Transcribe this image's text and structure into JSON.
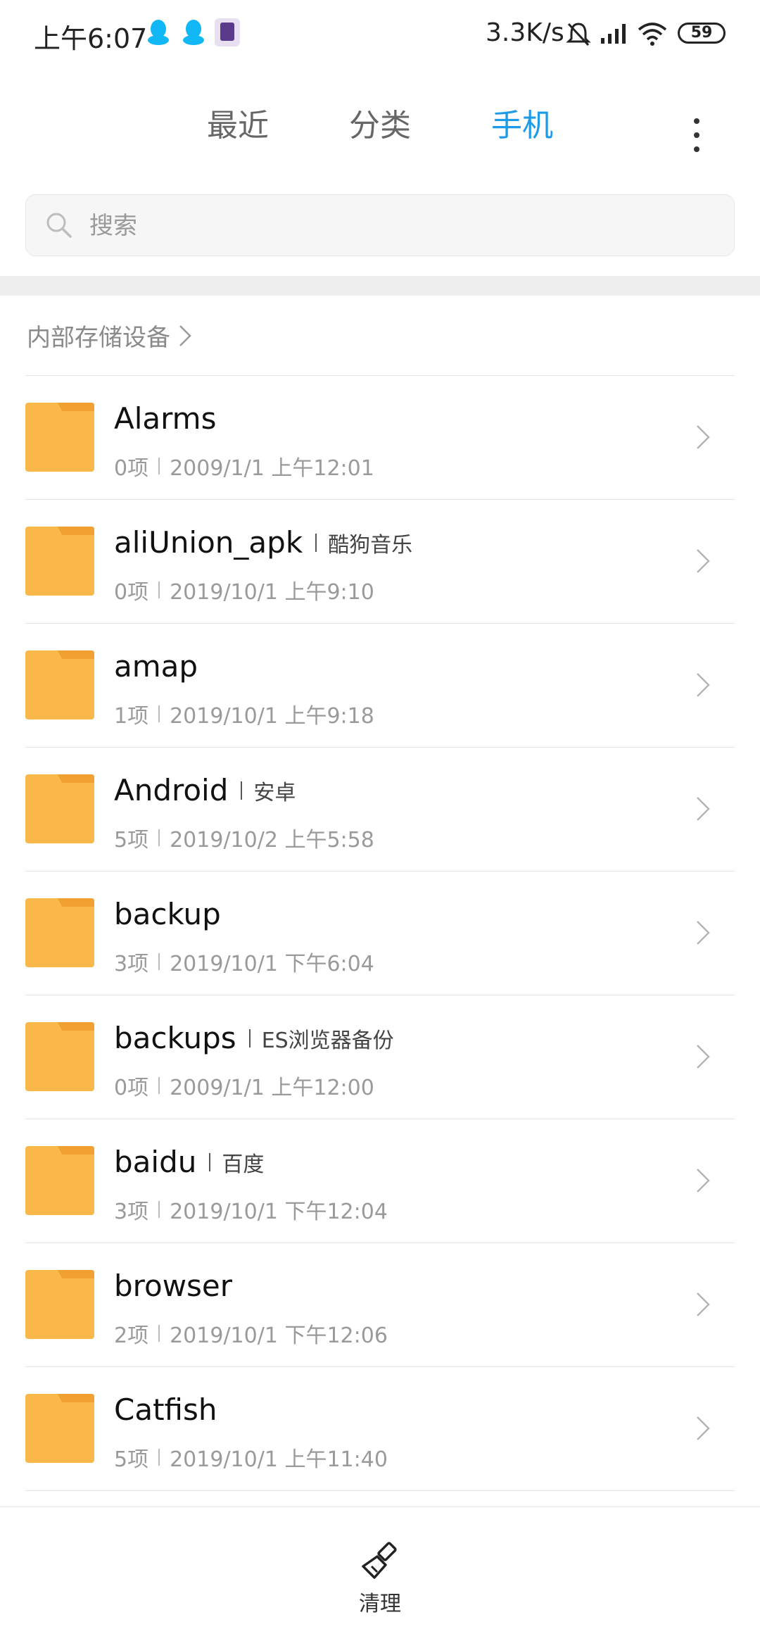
{
  "status_bar": {
    "time": "上午6:07",
    "net_speed": "3.3K/s",
    "battery": "59"
  },
  "tabs": [
    {
      "label": "最近",
      "active": false
    },
    {
      "label": "分类",
      "active": false
    },
    {
      "label": "手机",
      "active": true
    }
  ],
  "search": {
    "placeholder": "搜索"
  },
  "breadcrumb": {
    "label": "内部存储设备"
  },
  "colors": {
    "accent": "#1e9be8",
    "folder": "#fbb84a",
    "folder_tab": "#f0a132"
  },
  "files": [
    {
      "name": "Alarms",
      "tag": "",
      "count": "0项",
      "date": "2009/1/1 上午12:01"
    },
    {
      "name": "aliUnion_apk",
      "tag": "酷狗音乐",
      "count": "0项",
      "date": "2019/10/1 上午9:10"
    },
    {
      "name": "amap",
      "tag": "",
      "count": "1项",
      "date": "2019/10/1 上午9:18"
    },
    {
      "name": "Android",
      "tag": "安卓",
      "count": "5项",
      "date": "2019/10/2 上午5:58"
    },
    {
      "name": "backup",
      "tag": "",
      "count": "3项",
      "date": "2019/10/1 下午6:04"
    },
    {
      "name": "backups",
      "tag": "ES浏览器备份",
      "count": "0项",
      "date": "2009/1/1 上午12:00"
    },
    {
      "name": "baidu",
      "tag": "百度",
      "count": "3项",
      "date": "2019/10/1 下午12:04"
    },
    {
      "name": "browser",
      "tag": "",
      "count": "2项",
      "date": "2019/10/1 下午12:06"
    },
    {
      "name": "Catfish",
      "tag": "",
      "count": "5项",
      "date": "2019/10/1 上午11:40"
    }
  ],
  "bottom_bar": {
    "clean_label": "清理"
  }
}
